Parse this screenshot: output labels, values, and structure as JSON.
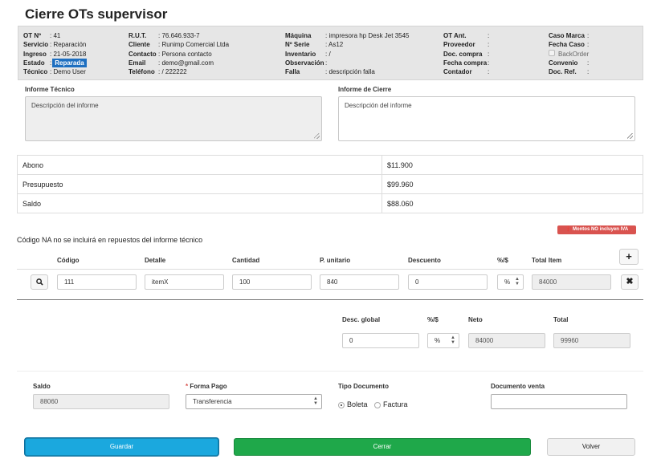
{
  "page": {
    "title": "Cierre OTs supervisor"
  },
  "info": {
    "col1": [
      {
        "k": "OT Nº",
        "v": ": 41"
      },
      {
        "k": "Servicio",
        "v": ": Reparación"
      },
      {
        "k": "Ingreso",
        "v": ": 21-05-2018"
      },
      {
        "k": "Estado",
        "v": ": ",
        "hl": "Reparada"
      },
      {
        "k": "Técnico",
        "v": ": Demo User"
      }
    ],
    "col2": [
      {
        "k": "R.U.T.",
        "v": ": 76.646.933-7"
      },
      {
        "k": "Cliente",
        "v": ": Runimp Comercial Ltda"
      },
      {
        "k": "Contacto",
        "v": ": Persona contacto"
      },
      {
        "k": "Email",
        "v": ": demo@gmail.com"
      },
      {
        "k": "Teléfono",
        "v": ": / 222222"
      }
    ],
    "col3": [
      {
        "k": "Máquina",
        "v": ": impresora hp Desk Jet 3545"
      },
      {
        "k": "Nº Serie",
        "v": ": As12"
      },
      {
        "k": "Inventario",
        "v": ": /"
      },
      {
        "k": "Observación",
        "v": ":"
      },
      {
        "k": "Falla",
        "v": ": descripción falla"
      }
    ],
    "col4": [
      {
        "k": "OT Ant.",
        "v": ":"
      },
      {
        "k": "Proveedor",
        "v": ":"
      },
      {
        "k": "Doc. compra",
        "v": ":"
      },
      {
        "k": "Fecha compra",
        "v": ":"
      },
      {
        "k": "Contador",
        "v": ":"
      }
    ],
    "col5": [
      {
        "k": "Caso Marca",
        "v": ":"
      },
      {
        "k": "Fecha Caso",
        "v": ":"
      },
      {
        "k": "",
        "v": "",
        "chk": "BackOrder"
      },
      {
        "k": "Convenio",
        "v": ":"
      },
      {
        "k": "Doc. Ref.",
        "v": ":"
      }
    ]
  },
  "informe_tecnico": {
    "label": "Informe Técnico",
    "value": "Descripción del informe"
  },
  "informe_cierre": {
    "label": "Informe de Cierre",
    "value": "Descripción del informe"
  },
  "summary": [
    {
      "label": "Abono",
      "value": "$11.900"
    },
    {
      "label": "Presupuesto",
      "value": "$99.960"
    },
    {
      "label": "Saldo",
      "value": "$88.060"
    }
  ],
  "badge": "Montos NO incluyen IVA",
  "note": "Código NA no se incluirá en repuestos del informe técnico",
  "items_headers": {
    "codigo": "Código",
    "detalle": "Detalle",
    "cantidad": "Cantidad",
    "punitario": "P. unitario",
    "descuento": "Descuento",
    "pct": "%/$",
    "total": "Total Item"
  },
  "item": {
    "codigo": "111",
    "detalle": "itemX",
    "cantidad": "100",
    "punitario": "840",
    "descuento": "0",
    "pct": "%",
    "total": "84000"
  },
  "totals_headers": {
    "desc": "Desc. global",
    "pct": "%/$",
    "neto": "Neto",
    "total": "Total"
  },
  "totals": {
    "desc": "0",
    "pct": "%",
    "neto": "84000",
    "total": "99960"
  },
  "footer": {
    "saldo_label": "Saldo",
    "saldo": "88060",
    "forma_pago_label": "Forma Pago",
    "forma_pago": "Transferencia",
    "tipo_doc_label": "Tipo Documento",
    "boleta": "Boleta",
    "factura": "Factura",
    "doc_venta_label": "Documento venta",
    "doc_venta": ""
  },
  "buttons": {
    "guardar": "Guardar",
    "cerrar": "Cerrar",
    "volver": "Volver"
  },
  "colors": {
    "guardar": "#1ba8de",
    "cerrar": "#1fa84a",
    "badge": "#d9534f",
    "estado": "#1e6fc0"
  }
}
